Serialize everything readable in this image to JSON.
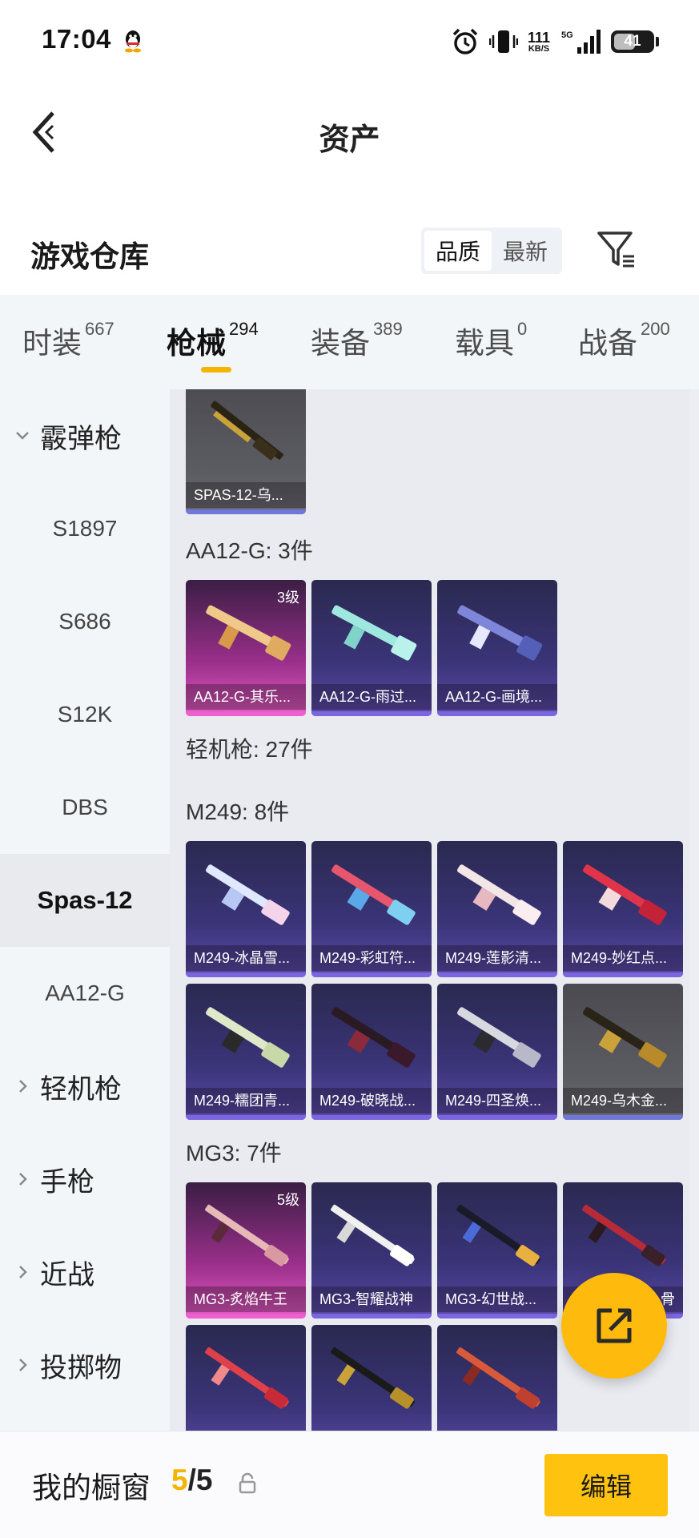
{
  "status_bar": {
    "time": "17:04",
    "net_speed_value": "111",
    "net_speed_unit": "KB/S",
    "signal_label": "5G",
    "battery": "41"
  },
  "header": {
    "title": "资产",
    "back_icon": "chevron-left-icon"
  },
  "section": {
    "title": "游戏仓库",
    "sort_quality": "品质",
    "sort_latest": "最新",
    "active_sort": "品质"
  },
  "tabs": [
    {
      "label": "时装",
      "count": "667"
    },
    {
      "label": "枪械",
      "count": "294",
      "active": true
    },
    {
      "label": "装备",
      "count": "389"
    },
    {
      "label": "载具",
      "count": "0"
    },
    {
      "label": "战备",
      "count": "200"
    }
  ],
  "sidebar": [
    {
      "label": "霰弹枪",
      "type": "group",
      "expanded": true
    },
    {
      "label": "S1897",
      "type": "item"
    },
    {
      "label": "S686",
      "type": "item"
    },
    {
      "label": "S12K",
      "type": "item"
    },
    {
      "label": "DBS",
      "type": "item"
    },
    {
      "label": "Spas-12",
      "type": "item",
      "active": true
    },
    {
      "label": "AA12-G",
      "type": "item"
    },
    {
      "label": "轻机枪",
      "type": "group"
    },
    {
      "label": "手枪",
      "type": "group"
    },
    {
      "label": "近战",
      "type": "group"
    },
    {
      "label": "投掷物",
      "type": "group"
    }
  ],
  "content": {
    "spas_cards": [
      {
        "name": "SPAS-12-乌...",
        "rarity": "gray"
      }
    ],
    "aa12_label": "AA12-G: 3件",
    "aa12_cards": [
      {
        "name": "AA12-G-其乐...",
        "rarity": "pink",
        "level": "3级"
      },
      {
        "name": "AA12-G-雨过...",
        "rarity": "purple"
      },
      {
        "name": "AA12-G-画境...",
        "rarity": "purple"
      }
    ],
    "lmg_label": "轻机枪: 27件",
    "m249_label": "M249: 8件",
    "m249_cards": [
      {
        "name": "M249-冰晶雪...",
        "rarity": "purple"
      },
      {
        "name": "M249-彩虹符...",
        "rarity": "purple"
      },
      {
        "name": "M249-莲影清...",
        "rarity": "purple"
      },
      {
        "name": "M249-妙红点...",
        "rarity": "purple"
      },
      {
        "name": "M249-糯团青...",
        "rarity": "purple"
      },
      {
        "name": "M249-破晓战...",
        "rarity": "purple"
      },
      {
        "name": "M249-四圣焕...",
        "rarity": "purple"
      },
      {
        "name": "M249-乌木金...",
        "rarity": "gray"
      }
    ],
    "mg3_label": "MG3: 7件",
    "mg3_cards": [
      {
        "name": "MG3-炙焰牛王",
        "rarity": "pink",
        "level": "5级"
      },
      {
        "name": "MG3-智耀战神",
        "rarity": "purple"
      },
      {
        "name": "MG3-幻世战...",
        "rarity": "purple"
      },
      {
        "name": "",
        "rarity": "purple",
        "partial_text": "骨"
      },
      {
        "name": "",
        "rarity": "purple"
      },
      {
        "name": "",
        "rarity": "purple"
      },
      {
        "name": "",
        "rarity": "purple"
      }
    ]
  },
  "fab": {
    "icon": "share-icon"
  },
  "bottom_bar": {
    "label": "我的橱窗",
    "current": "5",
    "separator": "/",
    "max": "5",
    "edit_label": "编辑"
  },
  "colors": {
    "accent": "#f4b400",
    "edit_button": "#ffc20e",
    "purple_card": "#3a3478",
    "pink_card": "#9a2f8a",
    "gray_card": "#5c5c63"
  }
}
